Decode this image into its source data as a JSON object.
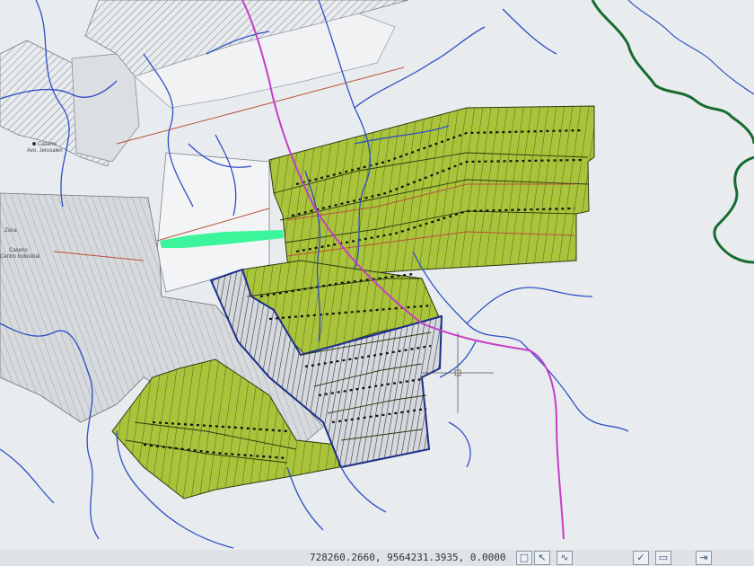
{
  "map": {
    "labels": {
      "caserio_jerusalen": "Caserio\nAvo. Jerusalen",
      "zona": "Zona",
      "caserio_industrial": "Caserio\nCentro Industrial"
    },
    "colors": {
      "background": "#e9ecef",
      "parcel_fill": "#a9c43a",
      "parcel_line": "#2a3a10",
      "river": "#2f4fc4",
      "road": "#c73cc7",
      "border": "#176b2f",
      "highlight": "#3cf59b",
      "boundary": "#1c2e8a"
    }
  },
  "statusbar": {
    "coordinates": "728260.2660, 9564231.3935, 0.0000",
    "buttons": [
      "snap-icon",
      "cursor-icon",
      "curve-icon",
      "check-icon",
      "window-icon",
      "arrows-icon"
    ]
  }
}
